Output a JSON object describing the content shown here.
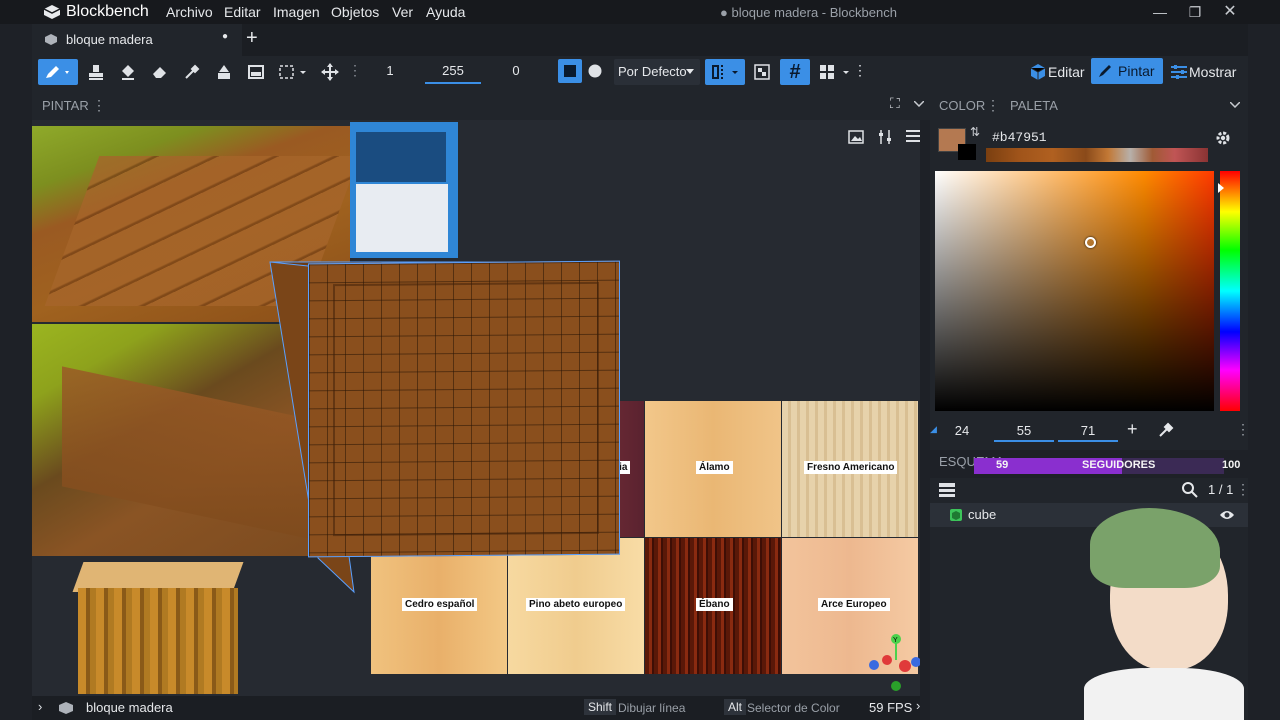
{
  "app": {
    "name": "Blockbench",
    "window_title": "● bloque madera - Blockbench"
  },
  "menu": [
    "Archivo",
    "Editar",
    "Imagen",
    "Objetos",
    "Ver",
    "Ayuda"
  ],
  "tab": {
    "label": "bloque madera"
  },
  "toolbar": {
    "brush_size": "1",
    "opacity": "255",
    "softness": "0",
    "blend_mode": "Por Defecto"
  },
  "modes": {
    "edit": "Editar",
    "paint": "Pintar",
    "display": "Mostrar"
  },
  "left_panel": {
    "title": "PINTAR"
  },
  "color_panel": {
    "tab_color": "COLOR",
    "tab_palette": "PALETA",
    "hex": "#b47951",
    "current_color": "#b47951",
    "h": "24",
    "s": "55",
    "v": "71"
  },
  "followers": {
    "left": "59",
    "label": "SEGUIDORES",
    "right": "100",
    "fill_fraction": 0.59
  },
  "outliner": {
    "title": "ESQUEMA",
    "count": "1 / 1",
    "items": [
      {
        "name": "cube"
      }
    ]
  },
  "woods": [
    {
      "name": "dia"
    },
    {
      "name": "Álamo"
    },
    {
      "name": "Fresno Americano"
    },
    {
      "name": "Cedro español"
    },
    {
      "name": "Pino abeto europeo"
    },
    {
      "name": "Ébano"
    },
    {
      "name": "Arce Europeo"
    }
  ],
  "status": {
    "project": "bloque madera",
    "key1": "Shift",
    "hint1": "Dibujar línea",
    "key2": "Alt",
    "hint2": "Selector de Color",
    "fps": "59 FPS"
  },
  "colors": {
    "accent": "#3b8fe6",
    "panel": "#21252b",
    "viewport": "#262a31"
  }
}
